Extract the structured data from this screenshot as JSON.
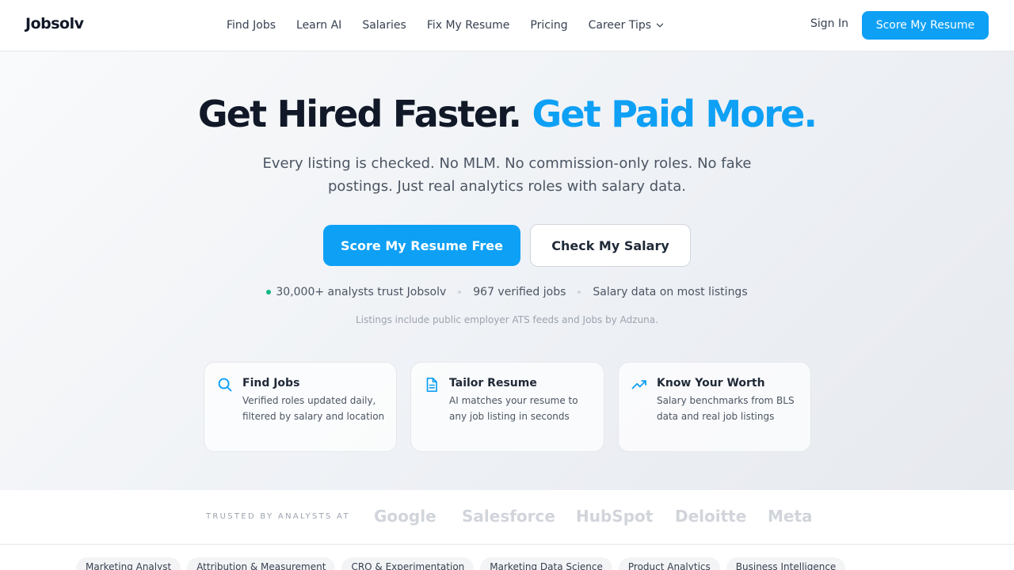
{
  "header": {
    "logo": "Jobsolv",
    "nav": [
      {
        "label": "Find Jobs"
      },
      {
        "label": "Learn AI"
      },
      {
        "label": "Salaries"
      },
      {
        "label": "Fix My Resume"
      },
      {
        "label": "Pricing"
      },
      {
        "label": "Career Tips",
        "icon": "chevron-down-icon"
      }
    ],
    "sign_in": "Sign In",
    "cta": "Score My Resume"
  },
  "hero": {
    "headline_dark": "Get Hired Faster.",
    "headline_accent": "Get Paid More.",
    "subhead": "Every listing is checked. No MLM. No commission-only roles. No fake postings. Just real analytics roles with salary data.",
    "primary_cta": "Score My Resume Free",
    "secondary_cta": "Check My Salary",
    "stats": [
      "30,000+ analysts trust Jobsolv",
      "967 verified jobs",
      "Salary data on most listings"
    ],
    "source_note": "Listings include public employer ATS feeds and Jobs by Adzuna."
  },
  "features": [
    {
      "icon": "search-icon",
      "title": "Find Jobs",
      "desc": "Verified roles updated daily, filtered by salary and location"
    },
    {
      "icon": "document-icon",
      "title": "Tailor Resume",
      "desc": "AI matches your resume to any job listing in seconds"
    },
    {
      "icon": "trending-up-icon",
      "title": "Know Your Worth",
      "desc": "Salary benchmarks from BLS data and real job listings"
    }
  ],
  "trusted": {
    "label": "TRUSTED BY ANALYSTS AT",
    "brands": [
      "Google",
      "Salesforce",
      "HubSpot",
      "Deloitte",
      "Meta"
    ]
  },
  "chips": [
    "Marketing Analyst",
    "Attribution & Measurement",
    "CRO & Experimentation",
    "Marketing Data Science",
    "Product Analytics",
    "Business Intelligence"
  ],
  "colors": {
    "accent": "#0ea0f5",
    "status_green": "#10b981"
  }
}
